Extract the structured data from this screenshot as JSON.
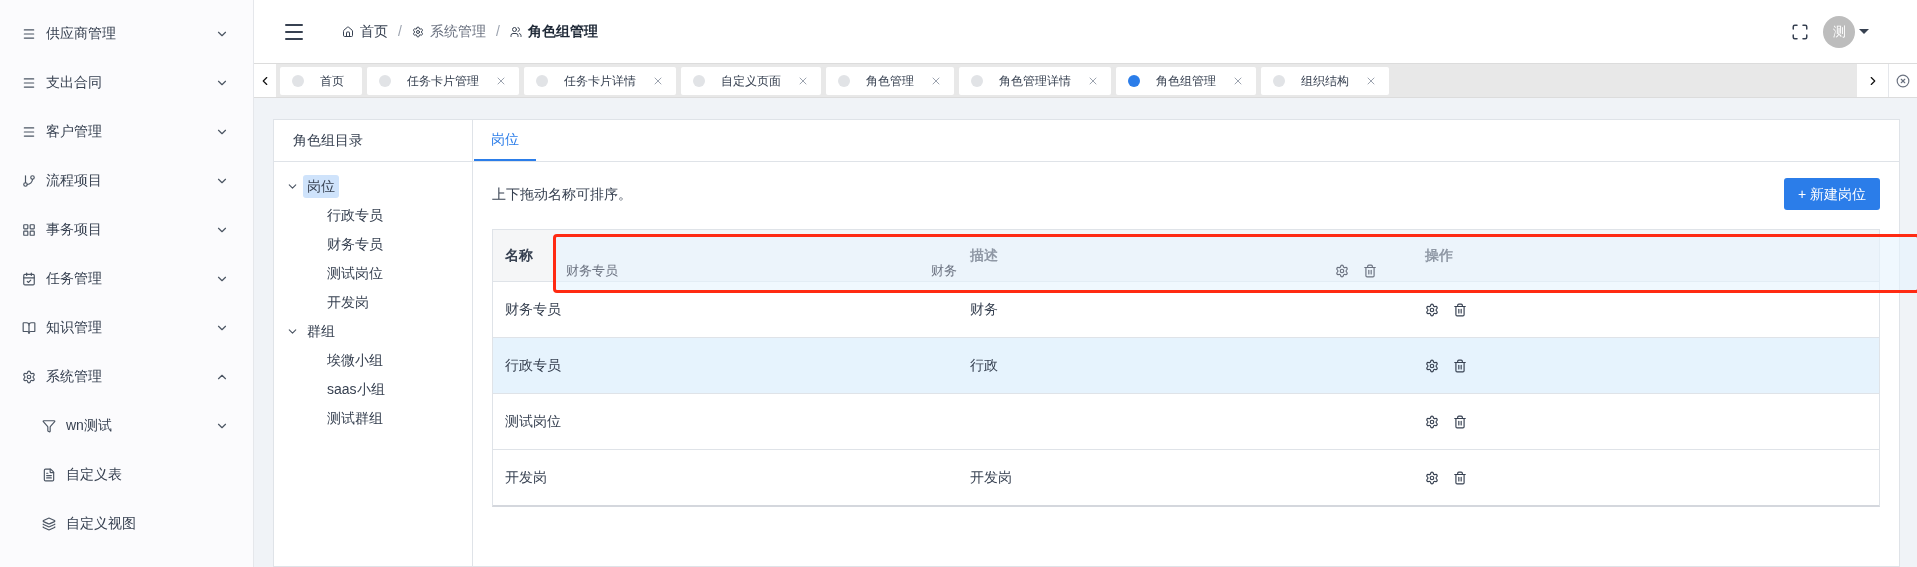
{
  "sidebar": {
    "items": [
      {
        "label": "供应商管理",
        "expanded": false
      },
      {
        "label": "支出合同",
        "expanded": false
      },
      {
        "label": "客户管理",
        "expanded": false
      },
      {
        "label": "流程项目",
        "expanded": false
      },
      {
        "label": "事务项目",
        "expanded": false
      },
      {
        "label": "任务管理",
        "expanded": false
      },
      {
        "label": "知识管理",
        "expanded": false
      },
      {
        "label": "系统管理",
        "expanded": true,
        "children": [
          {
            "label": "wn测试",
            "expanded": false
          },
          {
            "label": "自定义表"
          },
          {
            "label": "自定义视图"
          }
        ]
      }
    ]
  },
  "breadcrumb": [
    {
      "label": "首页",
      "current": false
    },
    {
      "separator": "/",
      "label": "系统管理",
      "current": false
    },
    {
      "separator": "/",
      "label": "角色组管理",
      "current": true
    }
  ],
  "avatar": {
    "text": "测"
  },
  "tabs": [
    {
      "label": "首页",
      "selected": false,
      "closable": false
    },
    {
      "label": "任务卡片管理",
      "selected": false,
      "closable": true
    },
    {
      "label": "任务卡片详情",
      "selected": false,
      "closable": true
    },
    {
      "label": "自定义页面",
      "selected": false,
      "closable": true
    },
    {
      "label": "角色管理",
      "selected": false,
      "closable": true
    },
    {
      "label": "角色管理详情",
      "selected": false,
      "closable": true
    },
    {
      "label": "角色组管理",
      "selected": true,
      "closable": true
    },
    {
      "label": "组织结构",
      "selected": false,
      "closable": true
    }
  ],
  "tree": {
    "title": "角色组目录",
    "nodes": [
      {
        "label": "岗位",
        "selected": true,
        "expanded": true,
        "children": [
          {
            "label": "行政专员",
            "selected": false
          },
          {
            "label": "财务专员",
            "selected": false
          },
          {
            "label": "测试岗位",
            "selected": false
          },
          {
            "label": "开发岗",
            "selected": false
          }
        ]
      },
      {
        "label": "群组",
        "selected": false,
        "expanded": true,
        "children": [
          {
            "label": "埃微小组",
            "selected": false
          },
          {
            "label": "saas小组",
            "selected": false
          },
          {
            "label": "测试群组",
            "selected": false
          }
        ]
      }
    ]
  },
  "content_tabs": [
    {
      "label": "岗位",
      "selected": true
    }
  ],
  "hint": "上下拖动名称可排序。",
  "new_button": "+ 新建岗位",
  "table": {
    "columns": [
      "名称",
      "描述",
      "操作"
    ],
    "dragging": {
      "name": "财务专员",
      "description": "财务"
    },
    "rows": [
      {
        "name": "财务专员",
        "description": "财务",
        "selected": false
      },
      {
        "name": "行政专员",
        "description": "行政",
        "selected": true
      },
      {
        "name": "测试岗位",
        "description": "",
        "selected": false
      },
      {
        "name": "开发岗",
        "description": "开发岗",
        "selected": false
      }
    ]
  }
}
